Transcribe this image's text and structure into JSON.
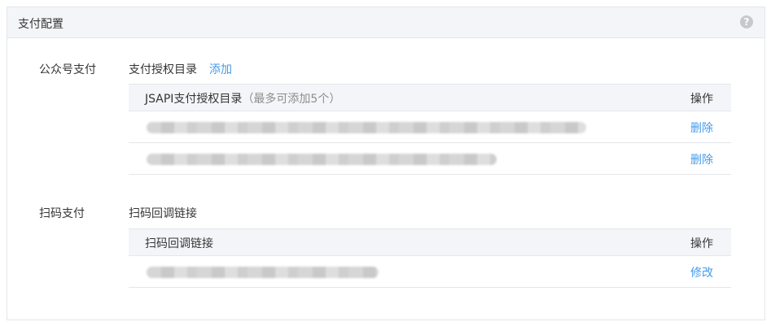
{
  "panel": {
    "title": "支付配置",
    "help_symbol": "?"
  },
  "jsapi_section": {
    "label": "公众号支付",
    "sub_title": "支付授权目录",
    "add_label": "添加",
    "table": {
      "header_main": "JSAPI支付授权目录",
      "header_note": "（最多可添加5个）",
      "header_action": "操作",
      "rows": [
        {
          "action": "删除"
        },
        {
          "action": "删除"
        }
      ]
    }
  },
  "scan_section": {
    "label": "扫码支付",
    "sub_title": "扫码回调链接",
    "table": {
      "header_main": "扫码回调链接",
      "header_action": "操作",
      "rows": [
        {
          "action": "修改"
        }
      ]
    }
  },
  "colors": {
    "link": "#459ae9",
    "header_bg": "#f4f5f9",
    "border": "#e4e6eb"
  }
}
